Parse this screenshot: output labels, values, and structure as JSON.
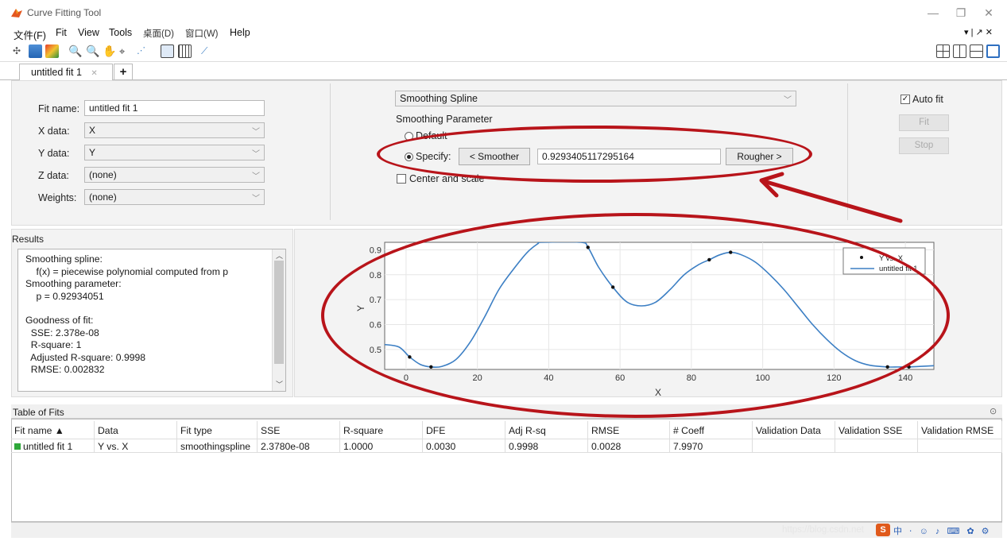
{
  "window": {
    "title": "Curve Fitting Tool",
    "controls": [
      "—",
      "❐",
      "✕"
    ],
    "menu_right": "▾ | ↗ ✕"
  },
  "menu": [
    "文件(F)",
    "Fit",
    "View",
    "Tools",
    "桌面(D)",
    "窗口(W)",
    "Help"
  ],
  "tabs": {
    "active": "untitled fit 1",
    "close_glyph": "✕",
    "add": "+"
  },
  "fit_setup": {
    "fit_name_label": "Fit name:",
    "fit_name_value": "untitled fit 1",
    "x_label": "X data:",
    "x_value": "X",
    "y_label": "Y data:",
    "y_value": "Y",
    "z_label": "Z data:",
    "z_value": "(none)",
    "w_label": "Weights:",
    "w_value": "(none)"
  },
  "fit_options": {
    "fit_type": "Smoothing Spline",
    "smoothing_heading": "Smoothing Parameter",
    "default_label": "Default",
    "specify_label": "Specify:",
    "smoother_button": "< Smoother",
    "smoothing_value": "0.9293405117295164",
    "rougher_button": "Rougher >",
    "center_scale_label": "Center and scale"
  },
  "fit_controls": {
    "auto_fit_label": "Auto fit",
    "auto_fit_checked": true,
    "fit_button": "Fit",
    "stop_button": "Stop"
  },
  "results": {
    "title": "Results",
    "lines": [
      "Smoothing spline:",
      "    f(x) = piecewise polynomial computed from p",
      "Smoothing parameter:",
      "    p = 0.92934051",
      "",
      "Goodness of fit:",
      "  SSE: 2.378e-08",
      "  R-square: 1",
      "  Adjusted R-square: 0.9998",
      "  RMSE: 0.002832"
    ]
  },
  "chart_data": {
    "type": "line",
    "xlabel": "X",
    "ylabel": "Y",
    "xlim": [
      -6,
      148
    ],
    "ylim": [
      0.42,
      0.93
    ],
    "xticks": [
      0,
      20,
      40,
      60,
      80,
      100,
      120,
      140
    ],
    "yticks": [
      0.5,
      0.6,
      0.7,
      0.8,
      0.9
    ],
    "grid": true,
    "legend_position": "top-right",
    "series": [
      {
        "name": "Y vs. X",
        "kind": "points",
        "color": "#111111",
        "x": [
          1,
          7,
          51,
          58,
          85,
          91,
          135,
          141
        ],
        "y": [
          0.47,
          0.43,
          0.91,
          0.75,
          0.86,
          0.89,
          0.43,
          0.43
        ]
      },
      {
        "name": "untitled fit 1",
        "kind": "line",
        "color": "#3c7fc4",
        "x": [
          -6,
          -2,
          1,
          4,
          7,
          10,
          14,
          18,
          22,
          26,
          30,
          34,
          37,
          38,
          49,
          51,
          54,
          58,
          62,
          66,
          70,
          74,
          78,
          82,
          85,
          88,
          91,
          94,
          98,
          102,
          106,
          110,
          114,
          118,
          122,
          126,
          130,
          135,
          138,
          141,
          144,
          148
        ],
        "y": [
          0.52,
          0.51,
          0.47,
          0.44,
          0.43,
          0.432,
          0.46,
          0.53,
          0.63,
          0.74,
          0.82,
          0.89,
          0.925,
          0.93,
          0.93,
          0.91,
          0.83,
          0.75,
          0.69,
          0.675,
          0.69,
          0.74,
          0.8,
          0.84,
          0.86,
          0.88,
          0.89,
          0.88,
          0.85,
          0.8,
          0.74,
          0.67,
          0.6,
          0.54,
          0.49,
          0.455,
          0.437,
          0.43,
          0.43,
          0.43,
          0.432,
          0.435
        ]
      }
    ]
  },
  "table_of_fits": {
    "title": "Table of Fits",
    "columns": [
      "Fit name ▲",
      "Data",
      "Fit type",
      "SSE",
      "R-square",
      "DFE",
      "Adj R-sq",
      "RMSE",
      "# Coeff",
      "Validation Data",
      "Validation SSE",
      "Validation RMSE"
    ],
    "rows": [
      [
        "untitled fit 1",
        "Y vs. X",
        "smoothingspline",
        "2.3780e-08",
        "1.0000",
        "0.0030",
        "0.9998",
        "0.0028",
        "7.9970",
        "",
        "",
        ""
      ]
    ],
    "row_marker_color": "#2fa83a"
  },
  "watermark": "https://blog.csdn.net",
  "annotation_color": "#b8141a"
}
